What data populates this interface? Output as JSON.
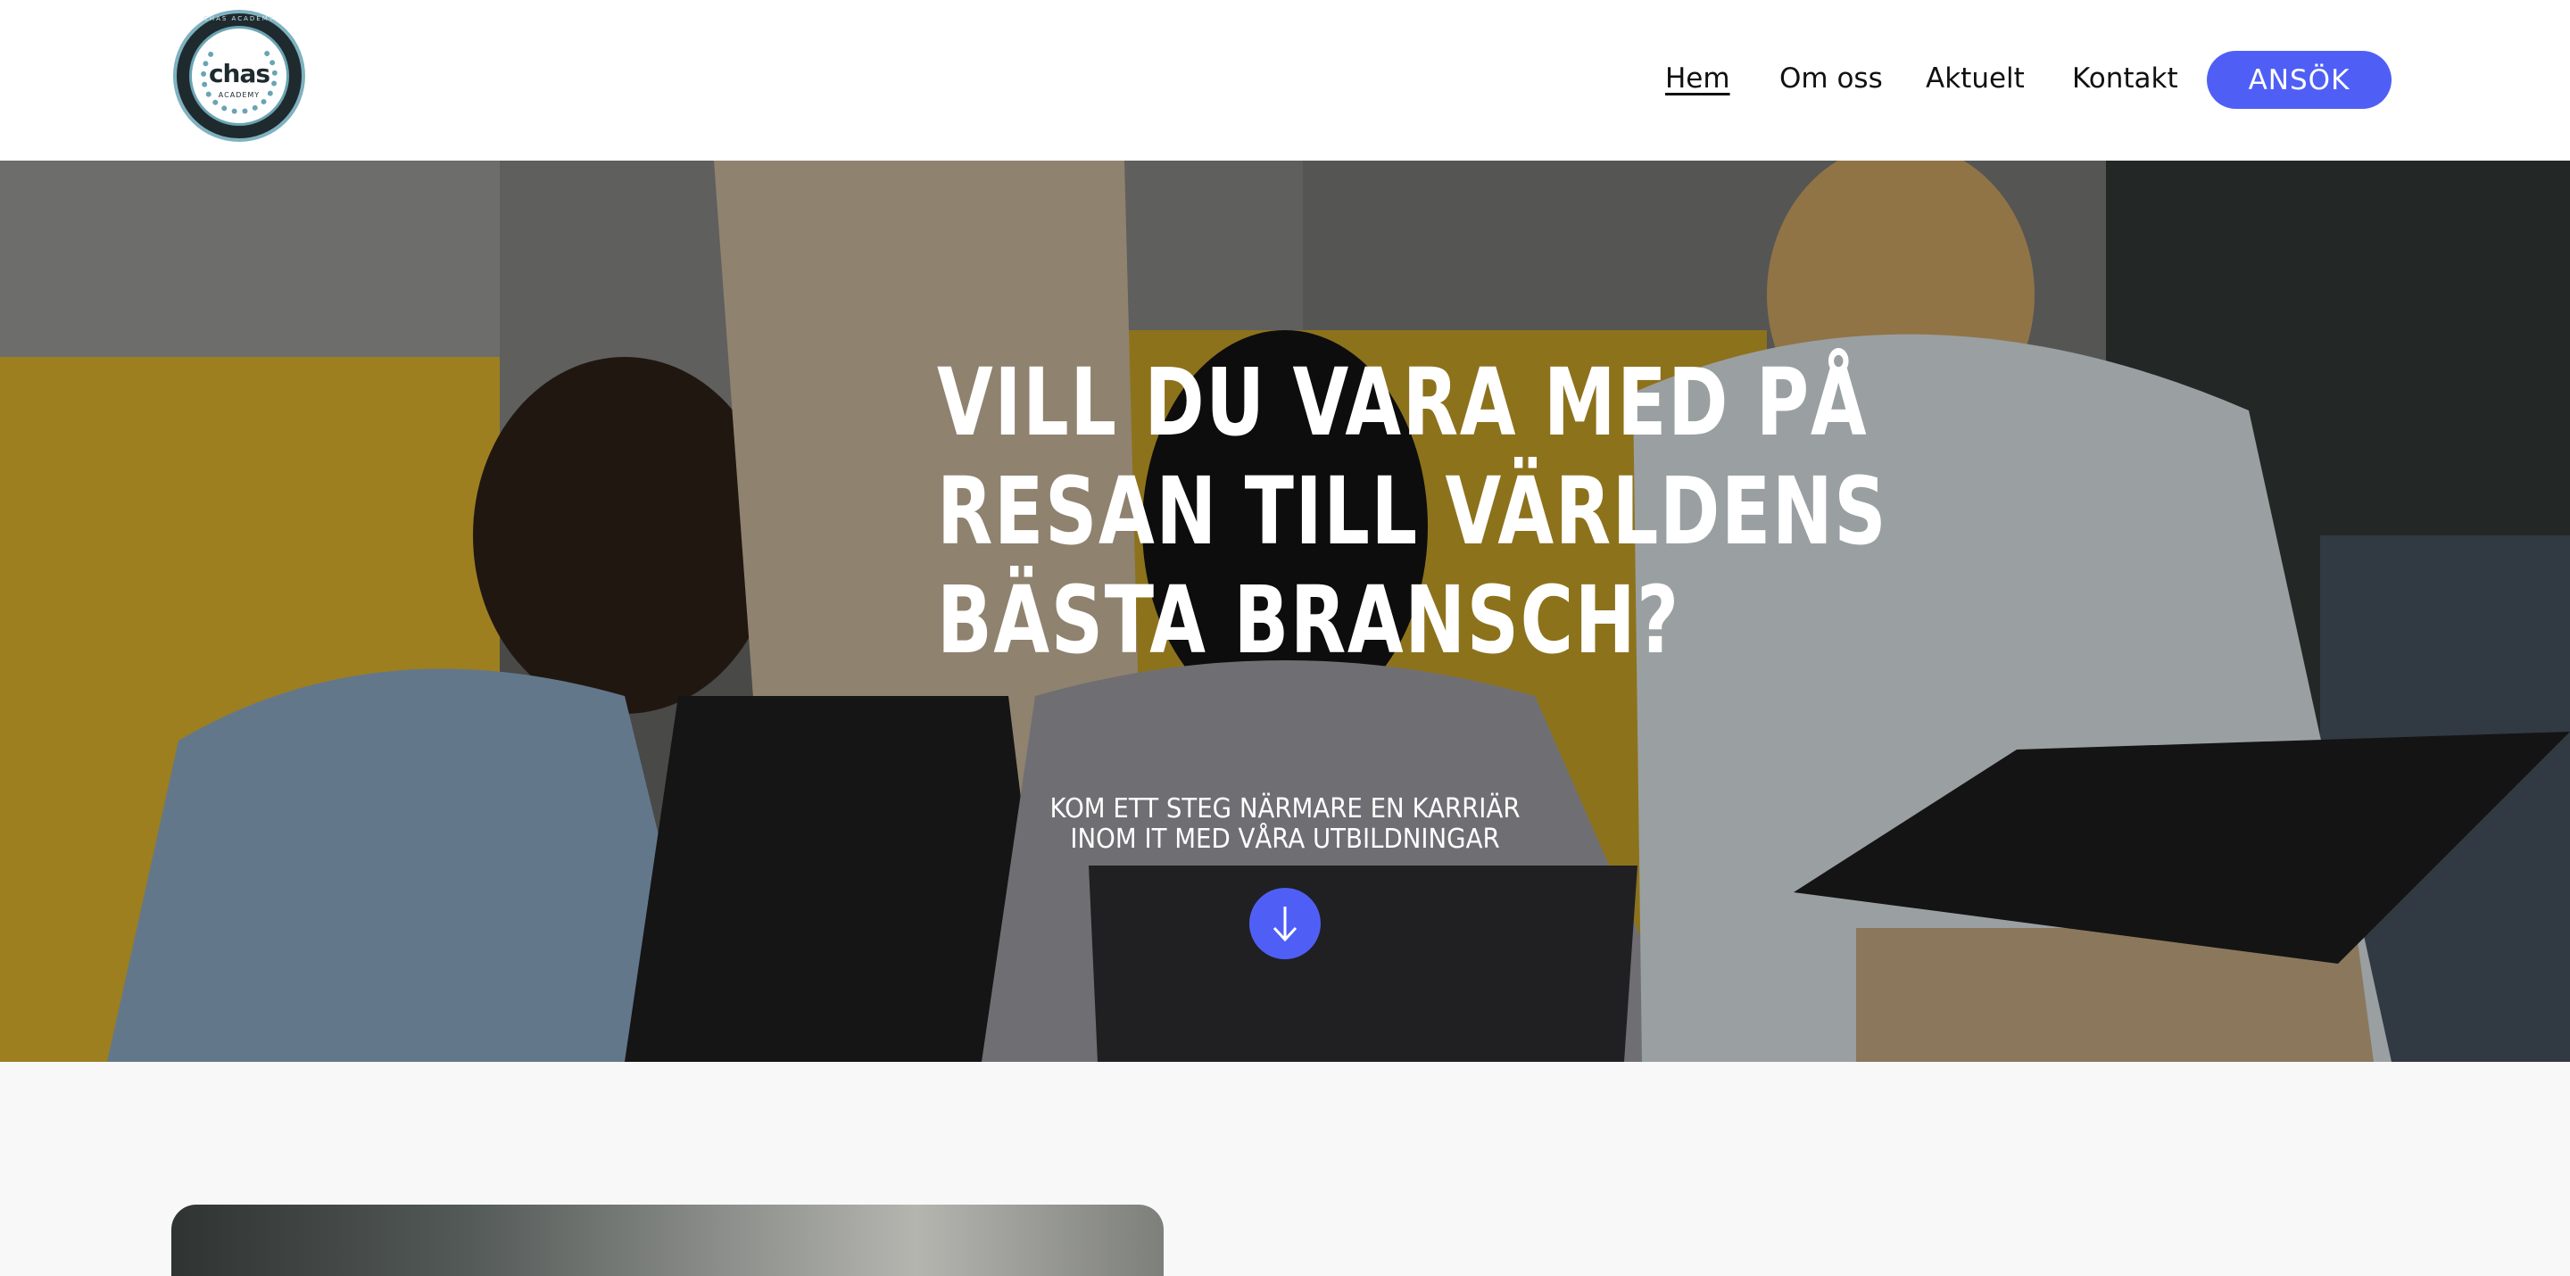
{
  "header": {
    "logo": {
      "name": "chas",
      "sub": "ACADEMY",
      "ring": "CHAS ACADEMY"
    },
    "nav": [
      {
        "label": "Hem",
        "active": true
      },
      {
        "label": "Om oss",
        "active": false
      },
      {
        "label": "Aktuelt",
        "active": false
      },
      {
        "label": "Kontakt",
        "active": false
      }
    ],
    "apply_label": "ANSÖK"
  },
  "hero": {
    "title_lines": [
      "VILL DU VARA MED PÅ",
      "RESAN TILL VÄRLDENS",
      "BÄSTA BRANSCH?"
    ],
    "subtitle_lines": [
      "KOM ETT STEG NÄRMARE EN KARRIÄR",
      "INOM IT MED VÅRA UTBILDNINGAR"
    ],
    "scroll_icon": "arrow-down-icon"
  },
  "colors": {
    "accent": "#4f5ff6",
    "header_bg": "#ffffff",
    "section_bg": "#f7f8f7",
    "text_dark": "#111111"
  }
}
